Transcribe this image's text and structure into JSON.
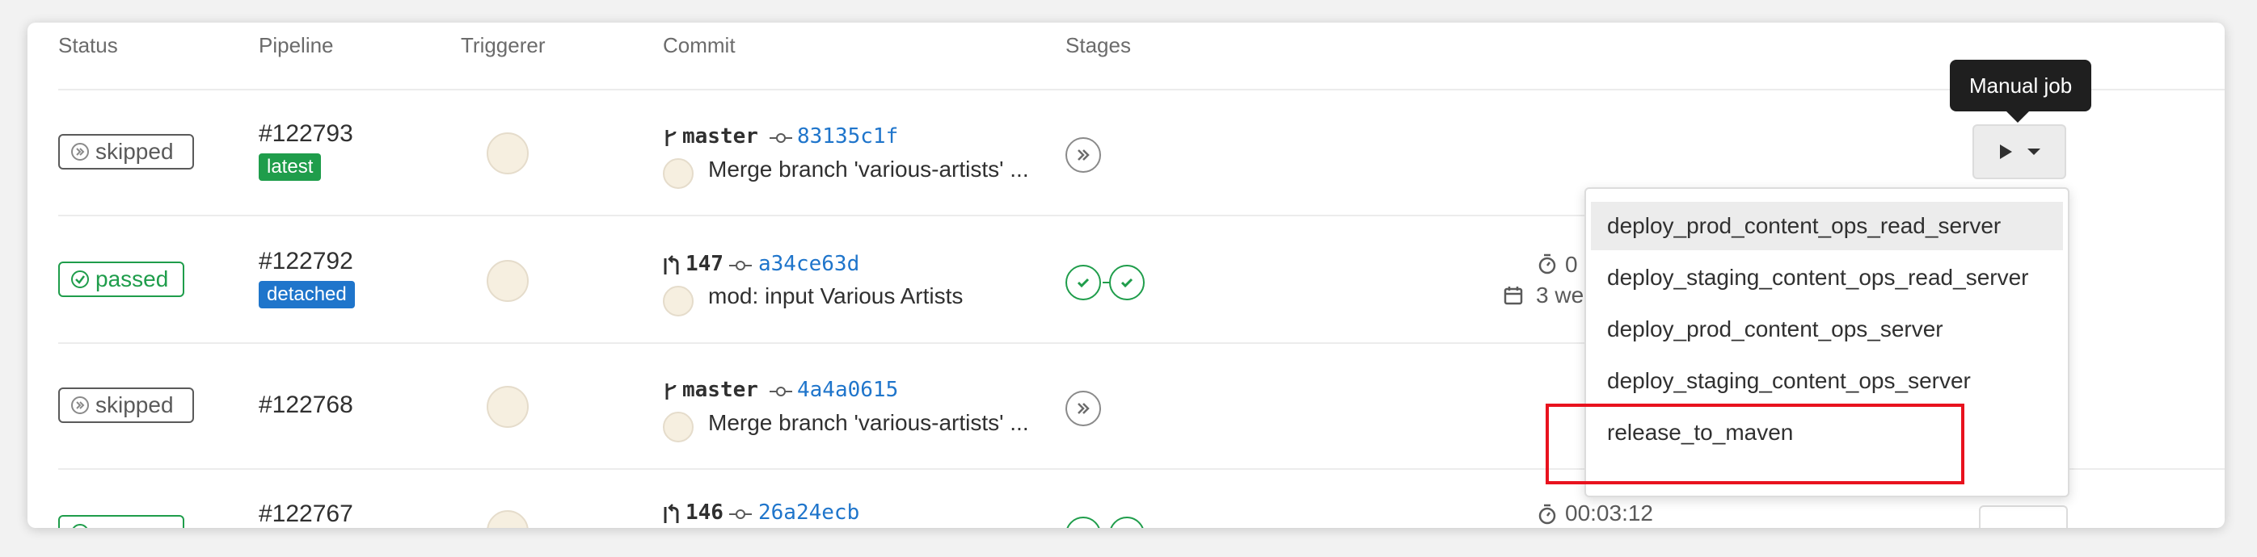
{
  "table": {
    "headers": {
      "status": "Status",
      "pipeline": "Pipeline",
      "triggerer": "Triggerer",
      "commit": "Commit",
      "stages": "Stages"
    },
    "rows": [
      {
        "status": "skipped",
        "pipeline_id": "#122793",
        "tag": "latest",
        "ref": "master",
        "sha": "83135c1f",
        "message": "Merge branch 'various-artists' ..."
      },
      {
        "status": "passed",
        "pipeline_id": "#122792",
        "tag": "detached",
        "ref": "147",
        "sha": "a34ce63d",
        "message": "mod: input Various Artists",
        "duration": "0",
        "finished": "3 we"
      },
      {
        "status": "skipped",
        "pipeline_id": "#122768",
        "ref": "master",
        "sha": "4a4a0615",
        "message": "Merge branch 'various-artists' ..."
      },
      {
        "status": "passed",
        "pipeline_id": "#122767",
        "ref": "146",
        "sha": "26a24ecb",
        "duration": "00:03:12"
      }
    ]
  },
  "tooltip": "Manual job",
  "manual_jobs": [
    "deploy_prod_content_ops_read_server",
    "deploy_staging_content_ops_read_server",
    "deploy_prod_content_ops_server",
    "deploy_staging_content_ops_server",
    "release_to_maven"
  ],
  "colors": {
    "passed": "#1f9d4b",
    "skipped": "#5a5a5a",
    "link": "#1f75cb",
    "highlight": "#e8121e",
    "tooltip_bg": "#1f1f1f"
  },
  "icons": {
    "skipped": "skipped-icon",
    "passed": "check-circle-icon",
    "branch": "branch-icon",
    "merge_request": "merge-request-icon",
    "commit": "commit-icon",
    "stage_skipped": "skipped-stage-icon",
    "stage_passed": "check-icon",
    "play": "play-icon",
    "caret": "chevron-down-icon",
    "timer": "timer-icon",
    "calendar": "calendar-icon"
  }
}
